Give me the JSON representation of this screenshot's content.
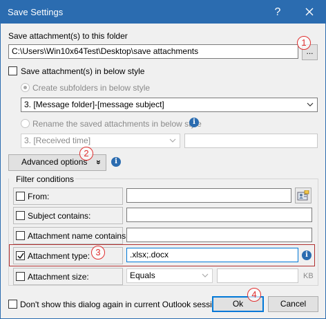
{
  "window": {
    "title": "Save Settings",
    "help_label": "?"
  },
  "save_folder": {
    "label": "Save attachment(s) to this folder",
    "path": "C:\\Users\\Win10x64Test\\Desktop\\save attachments",
    "browse_label": "..."
  },
  "style": {
    "checkbox_label": "Save attachment(s) in below style",
    "subfolders_label": "Create subfolders in below style",
    "subfolders_value": "3. [Message folder]-[message subject]",
    "rename_label": "Rename the saved attachments in below style",
    "rename_value": "3. [Received time]",
    "rename_extra": ""
  },
  "advanced": {
    "label": "Advanced options",
    "chevron": "»"
  },
  "filter": {
    "legend": "Filter conditions",
    "from_label": "From:",
    "from_value": "",
    "subject_label": "Subject contains:",
    "subject_value": "",
    "attachment_name_label": "Attachment name contains:",
    "attachment_name_value": "",
    "attachment_type_label": "Attachment type:",
    "attachment_type_value": ".xlsx;.docx",
    "attachment_size_label": "Attachment size:",
    "attachment_size_operator": "Equals",
    "attachment_size_value": "",
    "attachment_size_unit": "KB"
  },
  "footer": {
    "dont_show_label": "Don't show this dialog again in current Outlook session.",
    "ok_label": "Ok",
    "cancel_label": "Cancel"
  },
  "badges": [
    "1",
    "2",
    "3",
    "4"
  ],
  "colors": {
    "titlebar": "#2b6cb0",
    "annotation": "#e03030",
    "highlight": "#b03030"
  },
  "icons": {
    "close": "close-icon",
    "info": "info-icon",
    "contact": "contact-card-icon",
    "chevron": "double-chevron-down-icon",
    "dropdown": "chevron-down-icon"
  }
}
